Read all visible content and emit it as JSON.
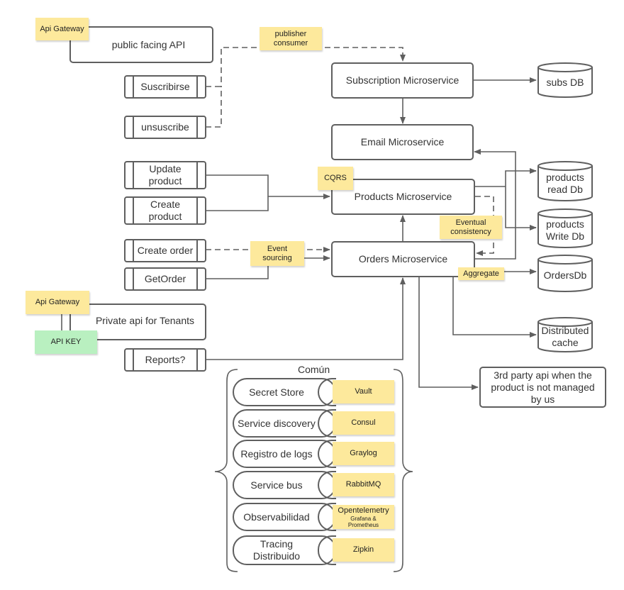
{
  "diagram": {
    "public_api": {
      "gateway_label": "Api Gateway",
      "title": "public facing API"
    },
    "private_api": {
      "gateway_label": "Api Gateway",
      "title": "Private api for Tenants",
      "key_label": "API KEY"
    },
    "endpoints": {
      "suscribirse": "Suscribirse",
      "unsuscribe": "unsuscribe",
      "update_product": "Update product",
      "create_product": "Create product",
      "create_order": "Create order",
      "get_order": "GetOrder",
      "reports": "Reports?"
    },
    "services": {
      "subscription": "Subscription Microservice",
      "email": "Email Microservice",
      "products": "Products Microservice",
      "orders": "Orders Microservice",
      "third_party": "3rd party api when the product is not managed by us"
    },
    "databases": {
      "subs": "subs DB",
      "products_read": "products read Db",
      "products_write": "products Write Db",
      "orders": "OrdersDb",
      "cache": "Distributed cache"
    },
    "notes": {
      "publisher_consumer": "publisher consumer",
      "cqrs": "CQRS",
      "eventual": "Eventual consistency",
      "event_sourcing": "Event sourcing",
      "aggregate": "Aggregate"
    },
    "common": {
      "title": "Común",
      "items": [
        {
          "label": "Secret Store",
          "tool": "Vault",
          "tool_sub": ""
        },
        {
          "label": "Service discovery",
          "tool": "Consul",
          "tool_sub": ""
        },
        {
          "label": "Registro de logs",
          "tool": "Graylog",
          "tool_sub": ""
        },
        {
          "label": "Service bus",
          "tool": "RabbitMQ",
          "tool_sub": ""
        },
        {
          "label": "Observabilidad",
          "tool": "Opentelemetry",
          "tool_sub": "Grafana & Prometheus"
        },
        {
          "label": "Tracing Distribuido",
          "tool": "Zipkin",
          "tool_sub": ""
        }
      ]
    }
  },
  "colors": {
    "sticky_yellow": "#fde99c",
    "sticky_green": "#b9f0c0",
    "line": "#5f5f5f"
  }
}
